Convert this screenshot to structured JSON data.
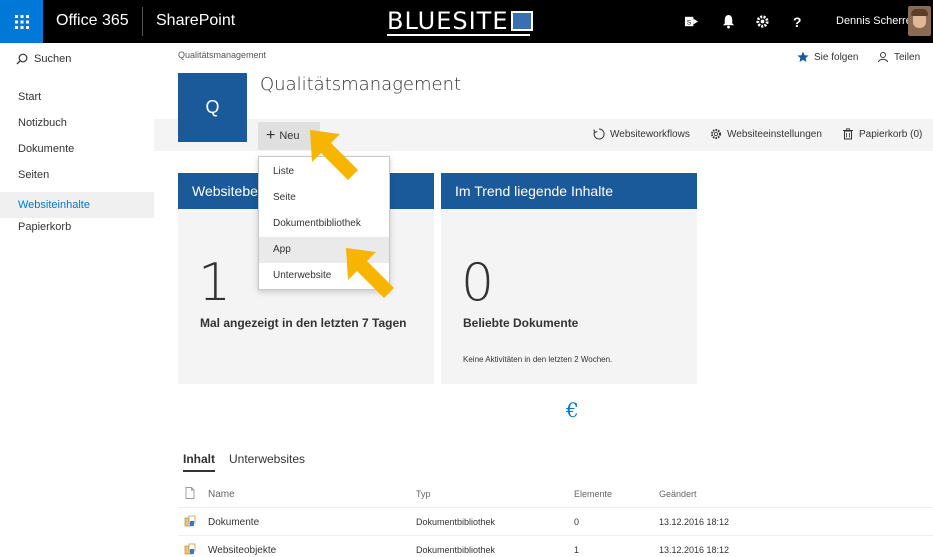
{
  "suitebar": {
    "product": "Office 365",
    "app": "SharePoint",
    "logo_text": "BLUESITE",
    "user_name": "Dennis Scherrer"
  },
  "leftnav": {
    "search_label": "Suchen",
    "items": [
      {
        "label": "Start",
        "active": false
      },
      {
        "label": "Notizbuch",
        "active": false
      },
      {
        "label": "Dokumente",
        "active": false
      },
      {
        "label": "Seiten",
        "active": false
      },
      {
        "label": "Websiteinhalte",
        "active": true
      },
      {
        "label": "Papierkorb",
        "active": false
      }
    ]
  },
  "header": {
    "breadcrumb": "Qualitätsmanagement",
    "title": "Qualitätsmanagement",
    "logo_letter": "Q",
    "follow_label": "Sie folgen",
    "share_label": "Teilen"
  },
  "commandbar": {
    "new_label": "Neu",
    "workflows_label": "Websiteworkflows",
    "settings_label": "Websiteeinstellungen",
    "recycle_label": "Papierkorb (0)"
  },
  "dropdown": {
    "items": [
      "Liste",
      "Seite",
      "Dokumentbibliothek",
      "App",
      "Unterwebsite"
    ],
    "highlighted": "App"
  },
  "cards": {
    "activity": {
      "title": "Websitebe",
      "number": "1",
      "caption": "Mal angezeigt in den letzten 7 Tagen"
    },
    "trending": {
      "title": "Im Trend liegende Inhalte",
      "number": "0",
      "caption": "Beliebte Dokumente",
      "subtext": "Keine Aktivitäten in den letzten 2 Wochen."
    }
  },
  "loading_glyph": "€",
  "tabs": [
    {
      "label": "Inhalt",
      "active": true
    },
    {
      "label": "Unterwebsites",
      "active": false
    }
  ],
  "content_list": {
    "columns": {
      "name": "Name",
      "type": "Typ",
      "count": "Elemente",
      "modified": "Geändert"
    },
    "rows": [
      {
        "name": "Dokumente",
        "type": "Dokumentbibliothek",
        "count": "0",
        "modified": "13.12.2016 18:12"
      },
      {
        "name": "Websiteobjekte",
        "type": "Dokumentbibliothek",
        "count": "1",
        "modified": "13.12.2016 18:12"
      }
    ]
  },
  "colors": {
    "suitebar": "#000000",
    "waffle": "#0078d7",
    "brand_blue": "#1a5a9b",
    "accent": "#0078d7",
    "arrow": "#f7b500"
  }
}
